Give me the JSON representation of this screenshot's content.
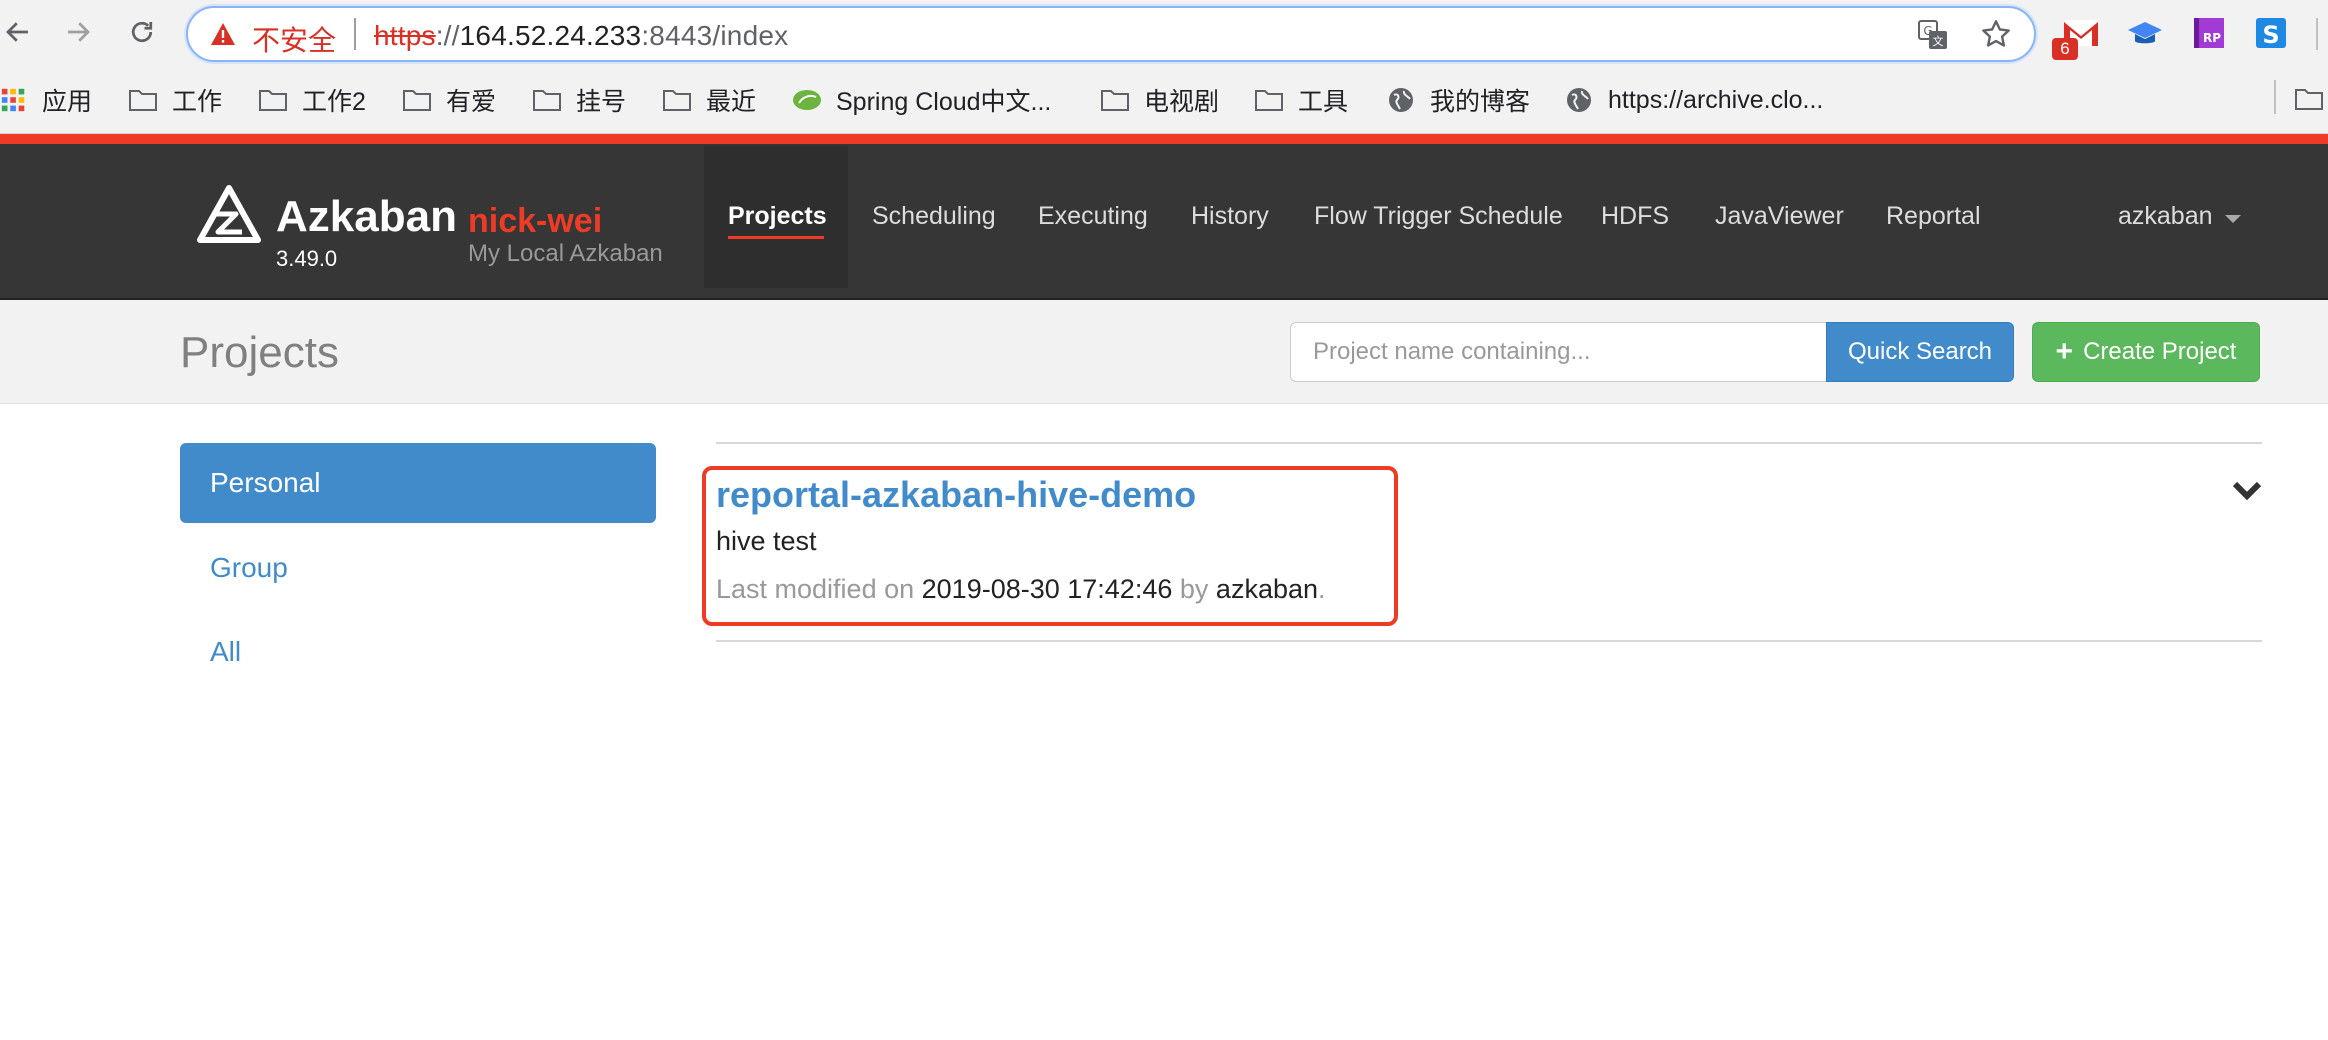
{
  "browser": {
    "security_label": "不安全",
    "url": {
      "scheme": "https",
      "separator": "://",
      "host": "164.52.24.233",
      "rest": ":8443/index"
    },
    "icons": {
      "back": "arrow-left-icon",
      "forward": "arrow-right-icon",
      "reload": "reload-icon",
      "warning": "warning-triangle-icon",
      "translate": "translate-icon",
      "bookmark": "star-icon"
    },
    "extensions": [
      {
        "name": "gmail",
        "badge": "6"
      },
      {
        "name": "graduation-cap"
      },
      {
        "name": "axure-rp"
      },
      {
        "name": "s-extension"
      }
    ]
  },
  "bookmarks": [
    {
      "label": "应用",
      "icon": "apps-grid-icon"
    },
    {
      "label": "工作",
      "icon": "folder-icon"
    },
    {
      "label": "工作2",
      "icon": "folder-icon"
    },
    {
      "label": "有爱",
      "icon": "folder-icon"
    },
    {
      "label": "挂号",
      "icon": "folder-icon"
    },
    {
      "label": "最近",
      "icon": "folder-icon"
    },
    {
      "label": "Spring Cloud中文...",
      "icon": "spring-leaf-icon"
    },
    {
      "label": "电视剧",
      "icon": "folder-icon"
    },
    {
      "label": "工具",
      "icon": "folder-icon"
    },
    {
      "label": "我的博客",
      "icon": "globe-icon"
    },
    {
      "label": "https://archive.clo...",
      "icon": "globe-icon"
    }
  ],
  "navbar": {
    "brand": "Azkaban",
    "version": "3.49.0",
    "env_name": "nick-wei",
    "env_desc": "My Local Azkaban",
    "links": [
      "Projects",
      "Scheduling",
      "Executing",
      "History",
      "Flow Trigger Schedule",
      "HDFS",
      "JavaViewer",
      "Reportal"
    ],
    "active": "Projects",
    "user": "azkaban"
  },
  "header": {
    "title": "Projects",
    "search_placeholder": "Project name containing...",
    "quick_search": "Quick Search",
    "create_project": "Create Project"
  },
  "sidebar": {
    "items": [
      {
        "label": "Personal",
        "active": true
      },
      {
        "label": "Group",
        "active": false
      },
      {
        "label": "All",
        "active": false
      }
    ]
  },
  "projects": [
    {
      "name": "reportal-azkaban-hive-demo",
      "description": "hive test",
      "meta_prefix": "Last modified on",
      "modified": "2019-08-30 17:42:46",
      "meta_by": "by",
      "owner": "azkaban",
      "meta_end": "."
    }
  ],
  "colors": {
    "accent_red": "#ee3b26",
    "primary_blue": "#428bca",
    "success_green": "#5cb85c",
    "navbar_bg": "#363636"
  }
}
